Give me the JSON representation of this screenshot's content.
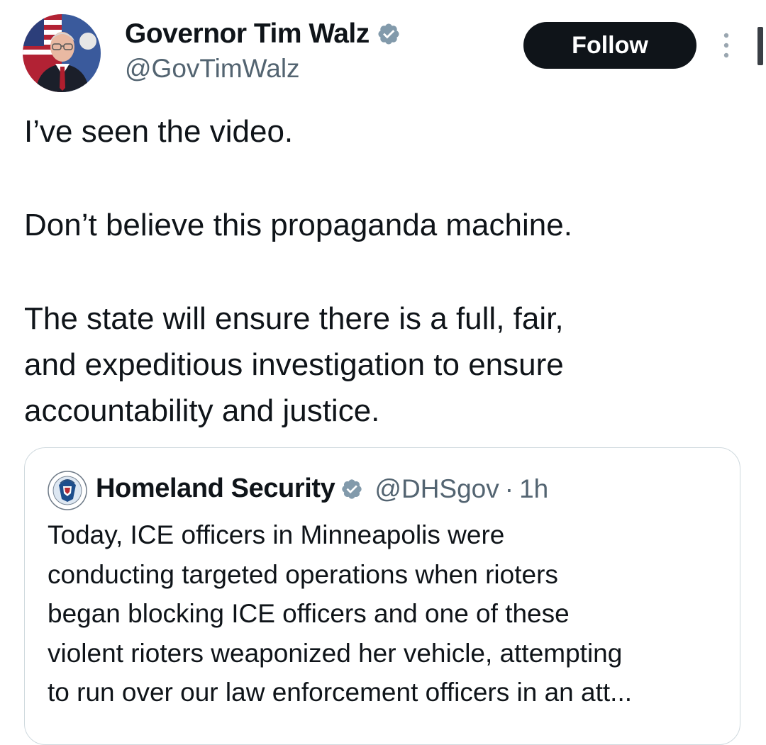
{
  "author": {
    "display_name": "Governor Tim Walz",
    "handle": "@GovTimWalz",
    "verified": true
  },
  "actions": {
    "follow_label": "Follow",
    "more_icon": "more-vertical-icon"
  },
  "tweet": {
    "lines": [
      "I’ve seen the video.",
      "Don’t believe this propaganda machine.",
      "The state will ensure there is a full, fair,",
      "and expeditious investigation to ensure",
      "accountability and justice."
    ]
  },
  "quoted_tweet": {
    "display_name": "Homeland Security",
    "handle": "@DHSgov",
    "separator": "·",
    "time": "1h",
    "verified": true,
    "lines": [
      "Today, ICE officers in Minneapolis were",
      "conducting targeted operations when rioters",
      "began blocking ICE officers and one of these",
      "violent rioters weaponized her vehicle, attempting",
      "to run over our law enforcement officers in an att..."
    ]
  },
  "colors": {
    "text": "#0f1419",
    "secondary_text": "#536471",
    "badge_gray": "#829aab",
    "follow_bg": "#0f1419",
    "card_border": "#cfd9de"
  }
}
